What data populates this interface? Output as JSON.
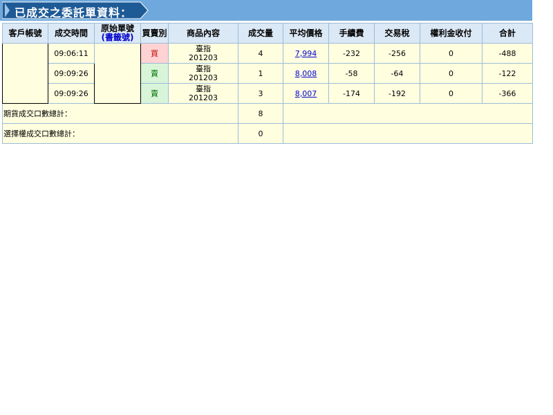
{
  "page": {
    "title": "已成交之委託單資料："
  },
  "table": {
    "columns": {
      "account": "客戶帳號",
      "time": "成交時間",
      "order_no_line1": "原始單號",
      "order_no_line2": "(書籤號)",
      "side": "買賣別",
      "product": "商品內容",
      "qty": "成交量",
      "avg_price": "平均價格",
      "fee": "手續費",
      "tax": "交易稅",
      "premium": "權利金收付",
      "total": "合計"
    },
    "rows": [
      {
        "time": "09:06:11",
        "side": "買",
        "product_name": "臺指",
        "product_month": "201203",
        "qty": "4",
        "avg_price": "7,994",
        "fee": "-232",
        "tax": "-256",
        "premium": "0",
        "total": "-488"
      },
      {
        "time": "09:09:26",
        "side": "賣",
        "product_name": "臺指",
        "product_month": "201203",
        "qty": "1",
        "avg_price": "8,008",
        "fee": "-58",
        "tax": "-64",
        "premium": "0",
        "total": "-122"
      },
      {
        "time": "09:09:26",
        "side": "賣",
        "product_name": "臺指",
        "product_month": "201203",
        "qty": "3",
        "avg_price": "8,007",
        "fee": "-174",
        "tax": "-192",
        "premium": "0",
        "total": "-366"
      }
    ],
    "summary": [
      {
        "label": "期貨成交口數總計：",
        "value": "8"
      },
      {
        "label": "選擇權成交口數總計：",
        "value": "0"
      }
    ]
  },
  "colors": {
    "header_bar": "#6fa8dc",
    "buy": "#c00000",
    "sell": "#007000",
    "link": "#0000cc"
  }
}
